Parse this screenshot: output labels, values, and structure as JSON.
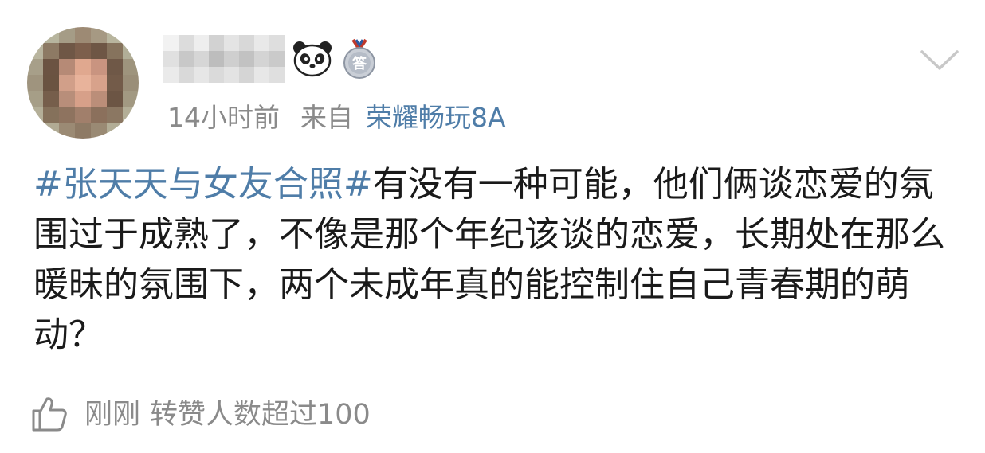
{
  "post": {
    "time": "14小时前",
    "from_label": "来自",
    "device": "荣耀畅玩8A",
    "topic": "#张天天与女友合照#",
    "body": "有没有一种可能，他们俩谈恋爱的氛围过于成熟了，不像是那个年纪该谈的恋爱，长期处在那么暖昧的氛围下，两个未成年真的能控制住自己青春期的萌动？",
    "medal_char": "答"
  },
  "footer": {
    "time": "刚刚",
    "text": "转赞人数超过100"
  },
  "icons": {
    "badge_1": "panda-icon",
    "badge_2": "medal-icon",
    "menu": "chevron-down-icon",
    "like": "thumbs-up-icon"
  },
  "colors": {
    "link": "#4f7da8",
    "meta_text": "#8a8a8a",
    "body_text": "#1a1a1a"
  }
}
